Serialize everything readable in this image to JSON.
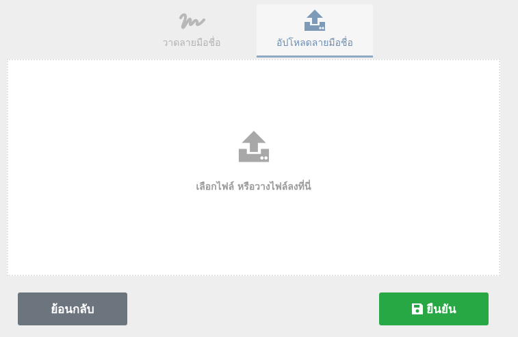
{
  "tabs": {
    "draw": {
      "label": "วาดลายมือชื่อ",
      "icon": "signature-icon"
    },
    "upload": {
      "label": "อัปโหลดลายมือชื่อ",
      "icon": "upload-icon",
      "active": true
    }
  },
  "dropzone": {
    "icon": "upload-icon",
    "text": "เลือกไฟล์ หรือวางไฟล์ลงที่นี่"
  },
  "buttons": {
    "back_label": "ย้อนกลับ",
    "confirm_label": "ยืนยัน",
    "confirm_icon": "save-icon"
  },
  "colors": {
    "background": "#eeeeee",
    "active_tab_accent": "#8fa8c3",
    "active_tab_text": "#6f8fb2",
    "inactive_tab_text": "#b3b3b3",
    "back_button": "#6c757d",
    "confirm_button": "#28a745",
    "dropzone_text": "#9a9a9a"
  }
}
